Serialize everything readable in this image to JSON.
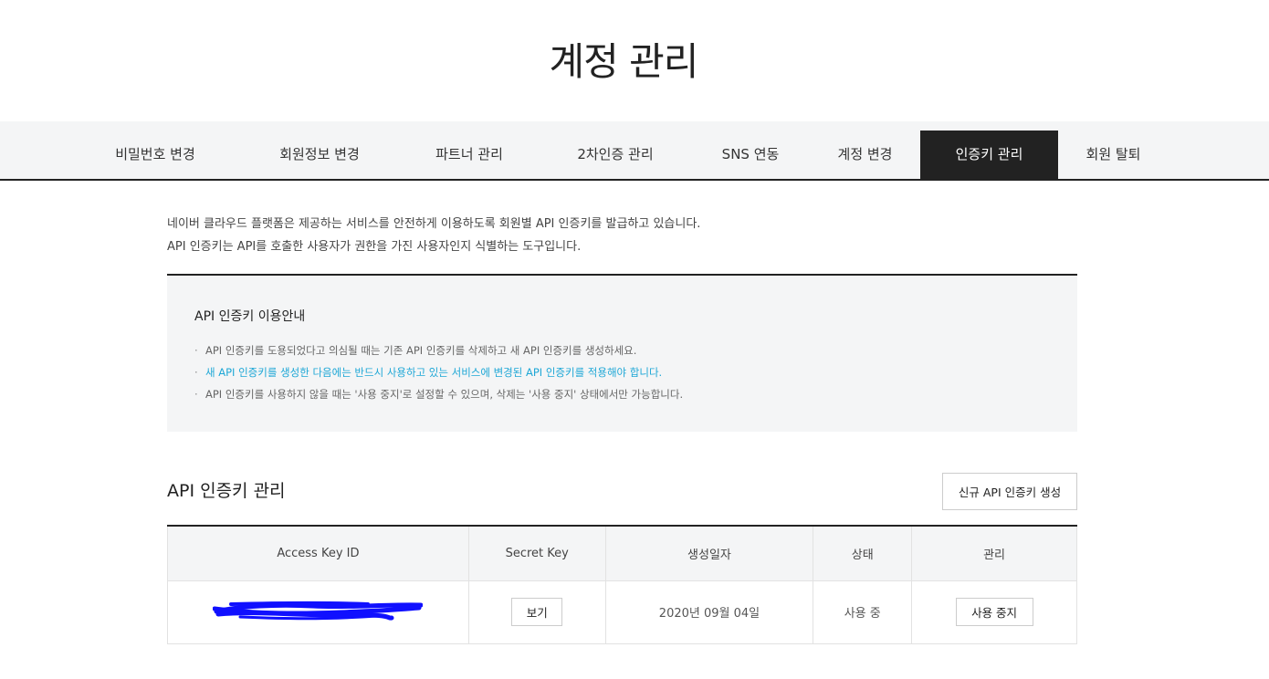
{
  "page": {
    "title": "계정 관리"
  },
  "tabs": [
    {
      "label": "비밀번호 변경",
      "active": false
    },
    {
      "label": "회원정보 변경",
      "active": false
    },
    {
      "label": "파트너 관리",
      "active": false
    },
    {
      "label": "2차인증 관리",
      "active": false
    },
    {
      "label": "SNS 연동",
      "active": false
    },
    {
      "label": "계정 변경",
      "active": false
    },
    {
      "label": "인증키 관리",
      "active": true
    },
    {
      "label": "회원 탈퇴",
      "active": false
    }
  ],
  "intro": {
    "line1": "네이버 클라우드 플랫폼은 제공하는 서비스를 안전하게 이용하도록 회원별 API 인증키를 발급하고 있습니다.",
    "line2": "API 인증키는 API를 호출한 사용자가 권한을 가진 사용자인지 식별하는 도구입니다."
  },
  "guide": {
    "title": "API 인증키 이용안내",
    "items": [
      "API 인증키를 도용되었다고 의심될 때는 기존 API 인증키를 삭제하고 새 API 인증키를 생성하세요.",
      "새 API 인증키를 생성한 다음에는 반드시 사용하고 있는 서비스에 변경된 API 인증키를 적용해야 합니다.",
      "API 인증키를 사용하지 않을 때는 '사용 중지'로 설정할 수 있으며, 삭제는 '사용 중지' 상태에서만 가능합니다."
    ],
    "highlight_color": "#1ea7d6"
  },
  "section": {
    "title": "API 인증키 관리",
    "create_button": "신규 API 인증키 생성"
  },
  "table": {
    "headers": [
      "Access Key ID",
      "Secret Key",
      "생성일자",
      "상태",
      "관리"
    ],
    "rows": [
      {
        "access_key": "",
        "secret_button": "보기",
        "created": "2020년 09월 04일",
        "status": "사용 중",
        "action_button": "사용 중지"
      }
    ]
  }
}
